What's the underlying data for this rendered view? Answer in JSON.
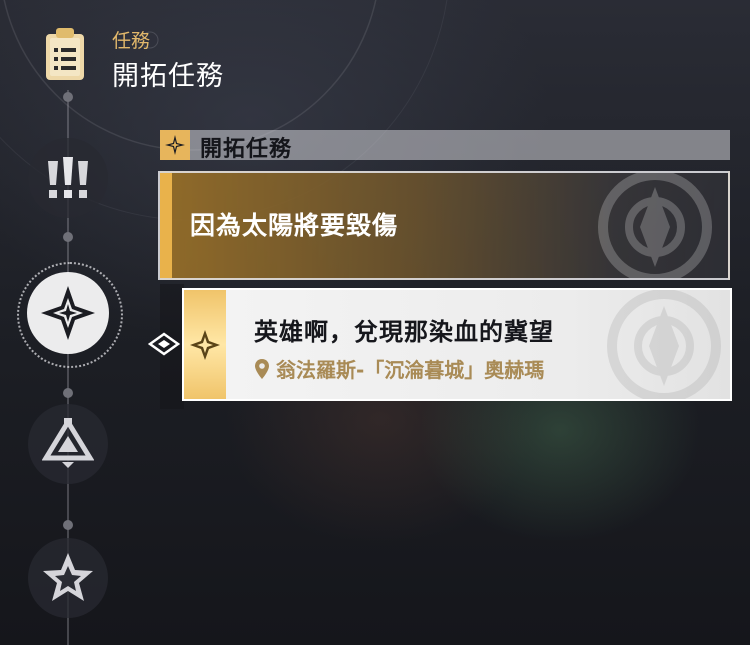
{
  "header": {
    "sub_label": "任務",
    "title": "開拓任務"
  },
  "sidebar": {
    "categories": [
      {
        "name": "important",
        "active": false
      },
      {
        "name": "trailblaze",
        "active": true
      },
      {
        "name": "companion",
        "active": false
      },
      {
        "name": "adventure",
        "active": false
      }
    ]
  },
  "section": {
    "label": "開拓任務"
  },
  "quests": [
    {
      "title": "因為太陽將要毀傷",
      "selected": false
    },
    {
      "title": "英雄啊，兌現那染血的冀望",
      "location": "翁法羅斯-「沉淪暮城」奧赫瑪",
      "selected": true
    }
  ],
  "colors": {
    "accent_gold": "#e7b55c",
    "location_text": "#a98b56"
  }
}
